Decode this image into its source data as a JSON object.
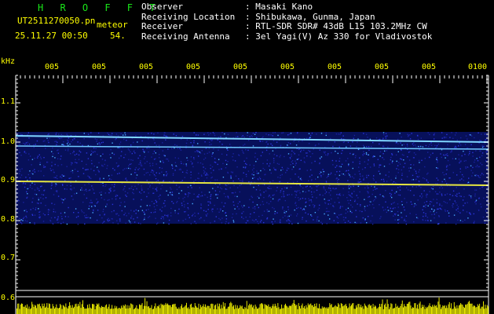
{
  "header": {
    "title": "H R O F F T",
    "filename": "UT2511270050.pn",
    "mode": "meteor",
    "timestamp": "25.11.27 00:50",
    "count": "54."
  },
  "station": [
    {
      "key": "Observer",
      "value": ": Masaki Kano"
    },
    {
      "key": "Receiving Location",
      "value": ": Shibukawa, Gunma, Japan"
    },
    {
      "key": "Receiver",
      "value": ": RTL-SDR SDR# 43dB L15 103.2MHz CW"
    },
    {
      "key": "Receiving Antenna",
      "value": ": 3el Yagi(V) Az 330 for Vladivostok"
    }
  ],
  "axis": {
    "unit": "kHz",
    "y_ticks": [
      "1.1",
      "1.0",
      "0.9",
      "0.8",
      "0.7",
      "0.6"
    ],
    "x_ticks": [
      "005",
      "005",
      "005",
      "005",
      "005",
      "005",
      "005",
      "005",
      "005",
      "0100"
    ]
  },
  "colors": {
    "label": "#ffff00",
    "title": "#19e619",
    "text": "#ffffff",
    "grid": "#ffffff",
    "signal": "#2a34d8",
    "bar": "#ffff00"
  }
}
